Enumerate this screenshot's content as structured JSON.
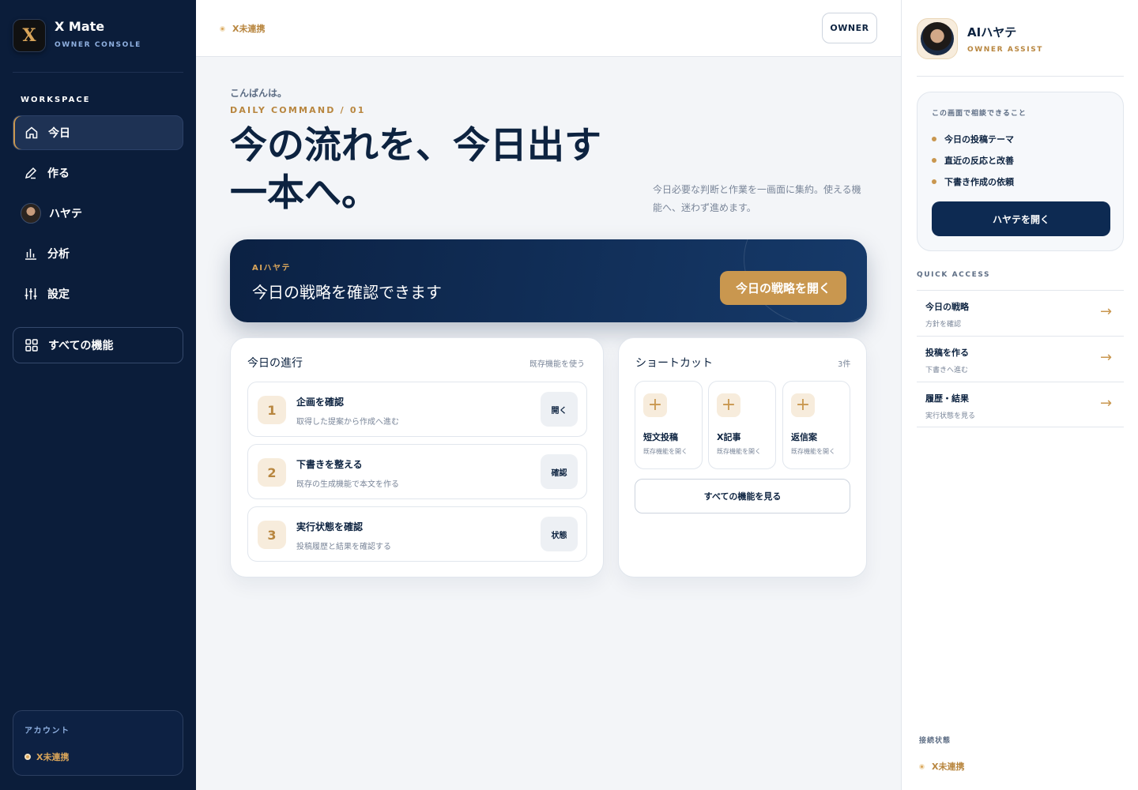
{
  "brand": {
    "logo_glyph": "X",
    "title": "X Mate",
    "subtitle": "OWNER CONSOLE"
  },
  "sidebar": {
    "section_label": "WORKSPACE",
    "items": [
      {
        "label": "今日",
        "icon": "home-icon",
        "active": true
      },
      {
        "label": "作る",
        "icon": "pen-icon"
      },
      {
        "label": "ハヤテ",
        "icon": "avatar"
      },
      {
        "label": "分析",
        "icon": "chart-icon"
      },
      {
        "label": "設定",
        "icon": "sliders-icon"
      }
    ],
    "all_features": {
      "label": "すべての機能",
      "icon": "grid-icon"
    },
    "account": {
      "label": "アカウント",
      "status": "X未連携"
    }
  },
  "topbar": {
    "status": "X未連携",
    "owner_button": "OWNER"
  },
  "main": {
    "greeting": "こんばんは。",
    "daily_label": "DAILY COMMAND / 01",
    "headline": "今の流れを、今日出す一本へ。",
    "description": "今日必要な判断と作業を一画面に集約。使える機能へ、迷わず進めます。",
    "hero": {
      "tag": "AIハヤテ",
      "title": "今日の戦略を確認できます",
      "button": "今日の戦略を開く"
    },
    "progress": {
      "title": "今日の進行",
      "meta": "既存機能を使う",
      "steps": [
        {
          "num": "1",
          "title": "企画を確認",
          "desc": "取得した提案から作成へ進む",
          "button": "開く"
        },
        {
          "num": "2",
          "title": "下書きを整える",
          "desc": "既存の生成機能で本文を作る",
          "button": "確認"
        },
        {
          "num": "3",
          "title": "実行状態を確認",
          "desc": "投稿履歴と結果を確認する",
          "button": "状態"
        }
      ]
    },
    "shortcuts": {
      "title": "ショートカット",
      "count": "3件",
      "items": [
        {
          "title": "短文投稿",
          "desc": "既存機能を開く"
        },
        {
          "title": "X記事",
          "desc": "既存機能を開く"
        },
        {
          "title": "返信案",
          "desc": "既存機能を開く"
        }
      ],
      "all_button": "すべての機能を見る"
    }
  },
  "assist": {
    "name": "AIハヤテ",
    "subtitle": "OWNER ASSIST",
    "consult_head": "この画面で相談できること",
    "consult_items": [
      "今日の投稿テーマ",
      "直近の反応と改善",
      "下書き作成の依頼"
    ],
    "open_button": "ハヤテを開く",
    "quick_access_label": "QUICK ACCESS",
    "quick_access": [
      {
        "title": "今日の戦略",
        "desc": "方針を確認"
      },
      {
        "title": "投稿を作る",
        "desc": "下書きへ進む"
      },
      {
        "title": "履歴・結果",
        "desc": "実行状態を見る"
      }
    ],
    "connection_label": "接続状態",
    "connection_status": "X未連携"
  },
  "colors": {
    "navy": "#0b1d3a",
    "gold": "#c9974f",
    "background": "#f3f5f8"
  }
}
